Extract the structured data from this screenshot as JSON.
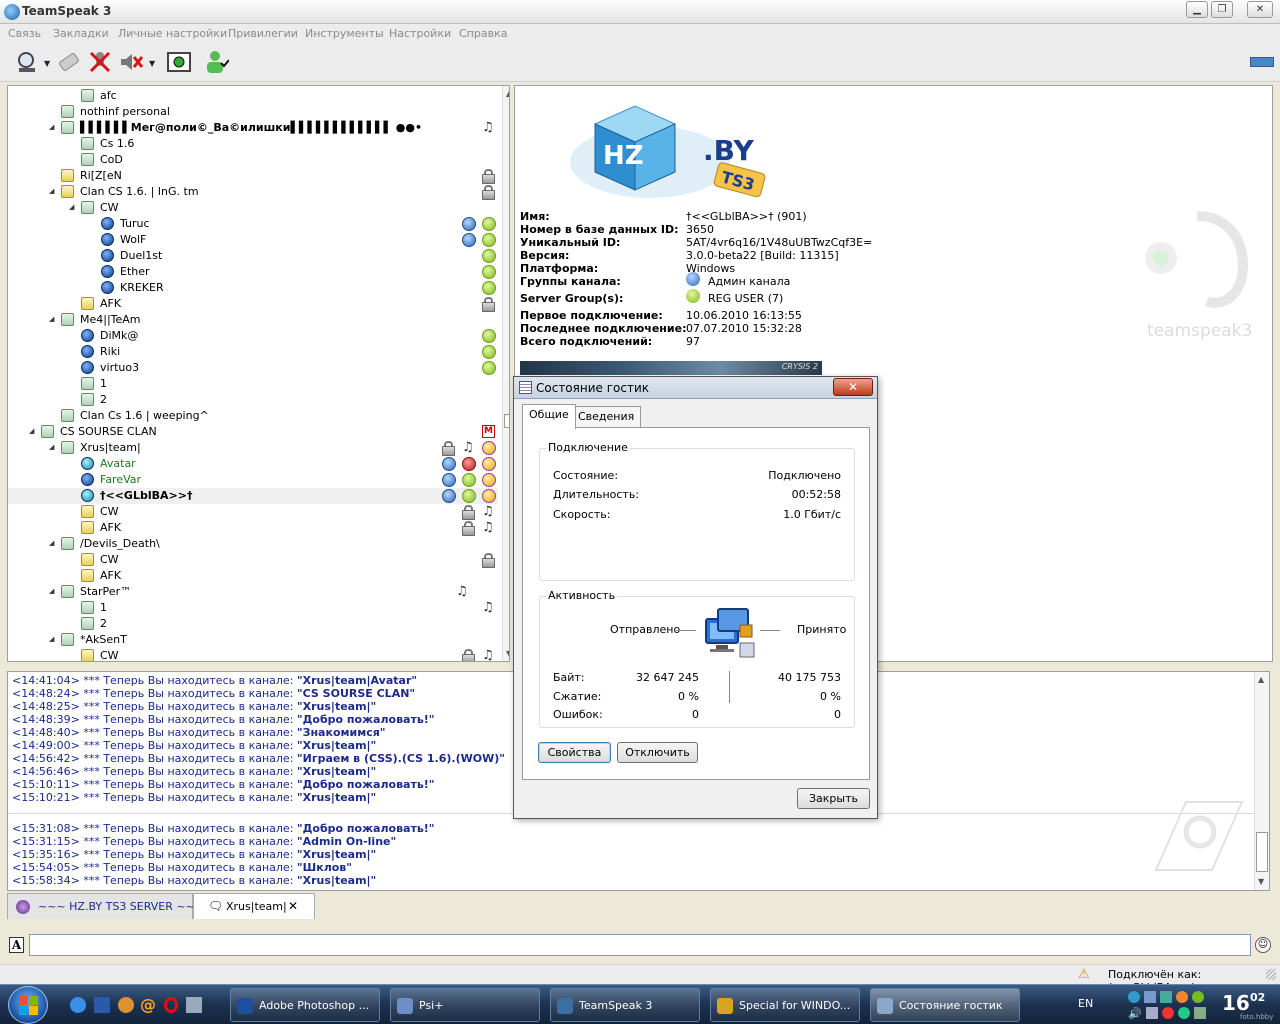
{
  "window": {
    "title": "TeamSpeak 3"
  },
  "menu": [
    "Связь",
    "Закладки",
    "Личные настройки",
    "Привилегии",
    "Инструменты",
    "Настройки",
    "Справка"
  ],
  "tree": [
    {
      "label": "afc",
      "indent": 5,
      "type": "ch",
      "arrow": false,
      "badges": []
    },
    {
      "label": "nothinf personal",
      "indent": 4,
      "type": "ch",
      "arrow": false,
      "badges": []
    },
    {
      "label": "▌▌▌▌▌▌Мег@поли©_Ва©илишки▌▌▌▌▌▌▌▌▌▌▌▌ ●●•",
      "indent": 4,
      "type": "ch",
      "arrow": true,
      "badges": [
        "music"
      ],
      "bold": true
    },
    {
      "label": "Cs 1.6",
      "indent": 5,
      "type": "ch",
      "arrow": false,
      "badges": []
    },
    {
      "label": "CoD",
      "indent": 5,
      "type": "ch",
      "arrow": false,
      "badges": []
    },
    {
      "label": "Ri[Z[eN",
      "indent": 4,
      "type": "ch yellow",
      "arrow": false,
      "badges": [
        "lock"
      ]
    },
    {
      "label": "Clan  CS 1.6. | InG. tm",
      "indent": 4,
      "type": "ch yellow",
      "arrow": true,
      "badges": [
        "lock"
      ]
    },
    {
      "label": "CW",
      "indent": 5,
      "type": "ch",
      "arrow": true,
      "badges": []
    },
    {
      "label": "Turuc",
      "indent": 6,
      "type": "user",
      "arrow": false,
      "badges": [
        "blue",
        "green"
      ]
    },
    {
      "label": "WolF",
      "indent": 6,
      "type": "user",
      "arrow": false,
      "badges": [
        "blue",
        "green"
      ]
    },
    {
      "label": "Duel1st",
      "indent": 6,
      "type": "user",
      "arrow": false,
      "badges": [
        "green"
      ]
    },
    {
      "label": "Ether",
      "indent": 6,
      "type": "user",
      "arrow": false,
      "badges": [
        "green"
      ]
    },
    {
      "label": "KREKER",
      "indent": 6,
      "type": "user",
      "arrow": false,
      "badges": [
        "green"
      ]
    },
    {
      "label": "AFK",
      "indent": 5,
      "type": "ch yellow",
      "arrow": false,
      "badges": [
        "lock"
      ]
    },
    {
      "label": "Me4||TeAm",
      "indent": 4,
      "type": "ch",
      "arrow": true,
      "badges": []
    },
    {
      "label": "DiMk@",
      "indent": 5,
      "type": "user",
      "arrow": false,
      "badges": [
        "green"
      ]
    },
    {
      "label": "Riki",
      "indent": 5,
      "type": "user",
      "arrow": false,
      "badges": [
        "green"
      ]
    },
    {
      "label": "virtuo3",
      "indent": 5,
      "type": "user",
      "arrow": false,
      "badges": [
        "green"
      ]
    },
    {
      "label": "1",
      "indent": 5,
      "type": "ch",
      "arrow": false,
      "badges": []
    },
    {
      "label": "2",
      "indent": 5,
      "type": "ch",
      "arrow": false,
      "badges": []
    },
    {
      "label": "Clan Cs 1.6 | weeping^",
      "indent": 4,
      "type": "ch",
      "arrow": false,
      "badges": []
    },
    {
      "label": "CS SOURSE CLAN",
      "indent": 3,
      "type": "ch",
      "arrow": true,
      "badges": [
        "m"
      ]
    },
    {
      "label": "Xrus|team|",
      "indent": 4,
      "type": "ch",
      "arrow": true,
      "badges": [
        "lock",
        "music",
        "star"
      ]
    },
    {
      "label": "Avatar",
      "indent": 5,
      "type": "user speak",
      "arrow": false,
      "badges": [
        "blue",
        "red",
        "star"
      ],
      "green": true
    },
    {
      "label": "FareVar",
      "indent": 5,
      "type": "user",
      "arrow": false,
      "badges": [
        "blue",
        "green",
        "star"
      ],
      "green": true
    },
    {
      "label": "†<<GLblBA>>†",
      "indent": 5,
      "type": "user speak",
      "arrow": false,
      "badges": [
        "blue",
        "green",
        "star"
      ],
      "bold": true,
      "selected": true
    },
    {
      "label": "CW",
      "indent": 5,
      "type": "ch yellow",
      "arrow": false,
      "badges": [
        "lock",
        "music"
      ]
    },
    {
      "label": "AFK",
      "indent": 5,
      "type": "ch yellow",
      "arrow": false,
      "badges": [
        "lock",
        "music"
      ]
    },
    {
      "label": "/Devils_Death\\",
      "indent": 4,
      "type": "ch",
      "arrow": true,
      "badges": []
    },
    {
      "label": "CW",
      "indent": 5,
      "type": "ch yellow",
      "arrow": false,
      "badges": [
        "lock"
      ]
    },
    {
      "label": "AFK",
      "indent": 5,
      "type": "ch yellow",
      "arrow": false,
      "badges": []
    },
    {
      "label": "StarPer™",
      "indent": 4,
      "type": "ch",
      "arrow": true,
      "badges": [
        "music2"
      ]
    },
    {
      "label": "1",
      "indent": 5,
      "type": "ch",
      "arrow": false,
      "badges": [
        "music"
      ]
    },
    {
      "label": "2",
      "indent": 5,
      "type": "ch",
      "arrow": false,
      "badges": []
    },
    {
      "label": "*AkSenT",
      "indent": 4,
      "type": "ch",
      "arrow": true,
      "badges": []
    },
    {
      "label": "CW",
      "indent": 5,
      "type": "ch yellow",
      "arrow": false,
      "badges": [
        "lock",
        "music"
      ]
    }
  ],
  "banner": {
    "logo_text_left": "HZ",
    "logo_text_right": ".BY",
    "logo_tag": "TS3",
    "watermark": "teamspeak3"
  },
  "client_info": [
    {
      "k": "Имя:",
      "v": "†<<GLblBA>>† (901)"
    },
    {
      "k": "Номер в базе данных ID:",
      "v": "3650"
    },
    {
      "k": "Уникальный ID:",
      "v": "5AT/4vr6q16/1V48uUBTwzCqf3E="
    },
    {
      "k": "Версия:",
      "v": "3.0.0-beta22 [Build: 11315]"
    },
    {
      "k": "Платформа:",
      "v": "Windows"
    },
    {
      "k": "Группы канала:",
      "v": "Админ канала"
    },
    {
      "k": "Server Group(s):",
      "v": "REG USER (7)"
    },
    {
      "k": "Первое подключение:",
      "v": "10.06.2010 16:13:55"
    },
    {
      "k": "Последнее подключение:",
      "v": "07.07.2010 15:32:28"
    },
    {
      "k": "Всего подключений:",
      "v": "97"
    }
  ],
  "avatar_text": "CRYSIS 2",
  "chat": [
    {
      "time": "<14:41:04>",
      "text": " *** Теперь Вы находитесь в канале: ",
      "ch": "\"Xrus|team|Avatar\""
    },
    {
      "time": "<14:48:24>",
      "text": " *** Теперь Вы находитесь в канале: ",
      "ch": "\"CS SOURSE CLAN\""
    },
    {
      "time": "<14:48:25>",
      "text": " *** Теперь Вы находитесь в канале: ",
      "ch": "\"Xrus|team|\""
    },
    {
      "time": "<14:48:39>",
      "text": " *** Теперь Вы находитесь в канале: ",
      "ch": "\"Добро пожаловать!\""
    },
    {
      "time": "<14:48:40>",
      "text": " *** Теперь Вы находитесь в канале: ",
      "ch": "\"Знакомимся\""
    },
    {
      "time": "<14:49:00>",
      "text": " *** Теперь Вы находитесь в канале: ",
      "ch": "\"Xrus|team|\""
    },
    {
      "time": "<14:56:42>",
      "text": " *** Теперь Вы находитесь в канале: ",
      "ch": "\"Играем в (CSS).(CS 1.6).(WOW)\""
    },
    {
      "time": "<14:56:46>",
      "text": " *** Теперь Вы находитесь в канале: ",
      "ch": "\"Xrus|team|\""
    },
    {
      "time": "<15:10:11>",
      "text": " *** Теперь Вы находитесь в канале: ",
      "ch": "\"Добро пожаловать!\""
    },
    {
      "time": "<15:10:21>",
      "text": " *** Теперь Вы находитесь в канале: ",
      "ch": "\"Xrus|team|\""
    },
    {
      "time": "<15:31:08>",
      "text": " *** Теперь Вы находитесь в канале: ",
      "ch": "\"Добро пожаловать!\""
    },
    {
      "time": "<15:31:15>",
      "text": " *** Теперь Вы находитесь в канале: ",
      "ch": "\"Admin On-line\""
    },
    {
      "time": "<15:35:16>",
      "text": " *** Теперь Вы находитесь в канале: ",
      "ch": "\"Xrus|team|\""
    },
    {
      "time": "<15:54:05>",
      "text": " *** Теперь Вы находитесь в канале: ",
      "ch": "\"Шклов\""
    },
    {
      "time": "<15:58:34>",
      "text": " *** Теперь Вы находитесь в канале: ",
      "ch": "\"Xrus|team|\""
    }
  ],
  "tabs": [
    {
      "label": "~~~ HZ.BY TS3 SERVER ~~~"
    },
    {
      "label": "Xrus|team|",
      "close": "✕"
    }
  ],
  "input": {
    "value": "",
    "format_icon": "A"
  },
  "status": {
    "text": "Подключён как: †<<GLblBA>>†"
  },
  "dialog": {
    "title": "Состояние гостик",
    "close": "✕",
    "tabs": [
      "Общие",
      "Сведения"
    ],
    "connection": {
      "title": "Подключение",
      "rows": [
        {
          "k": "Состояние:",
          "v": "Подключено"
        },
        {
          "k": "Длительность:",
          "v": "00:52:58"
        },
        {
          "k": "Скорость:",
          "v": "1.0 Гбит/с"
        }
      ]
    },
    "activity": {
      "title": "Активность",
      "sent_label": "Отправлено",
      "recv_label": "Принято",
      "rows": [
        {
          "k": "Байт:",
          "sent": "32 647 245",
          "recv": "40 175 753"
        },
        {
          "k": "Сжатие:",
          "sent": "0 %",
          "recv": "0 %"
        },
        {
          "k": "Ошибок:",
          "sent": "0",
          "recv": "0"
        }
      ]
    },
    "buttons": {
      "props": "Свойства",
      "disconnect": "Отключить",
      "close": "Закрыть"
    }
  },
  "taskbar": {
    "tasks": [
      {
        "label": "Adobe Photoshop ...",
        "color": "#1d4f9c"
      },
      {
        "label": "Psi+",
        "color": "#6c8fc9"
      },
      {
        "label": "TeamSpeak 3",
        "color": "#3b6fa3"
      },
      {
        "label": "Special for WINDO...",
        "color": "#d6a420"
      },
      {
        "label": "Состояние гостик",
        "color": "#8aa7cc",
        "active": true
      }
    ],
    "lang": "EN",
    "clock_hour": "16",
    "clock_min": "02",
    "clock_sub": "foto.hbby"
  }
}
